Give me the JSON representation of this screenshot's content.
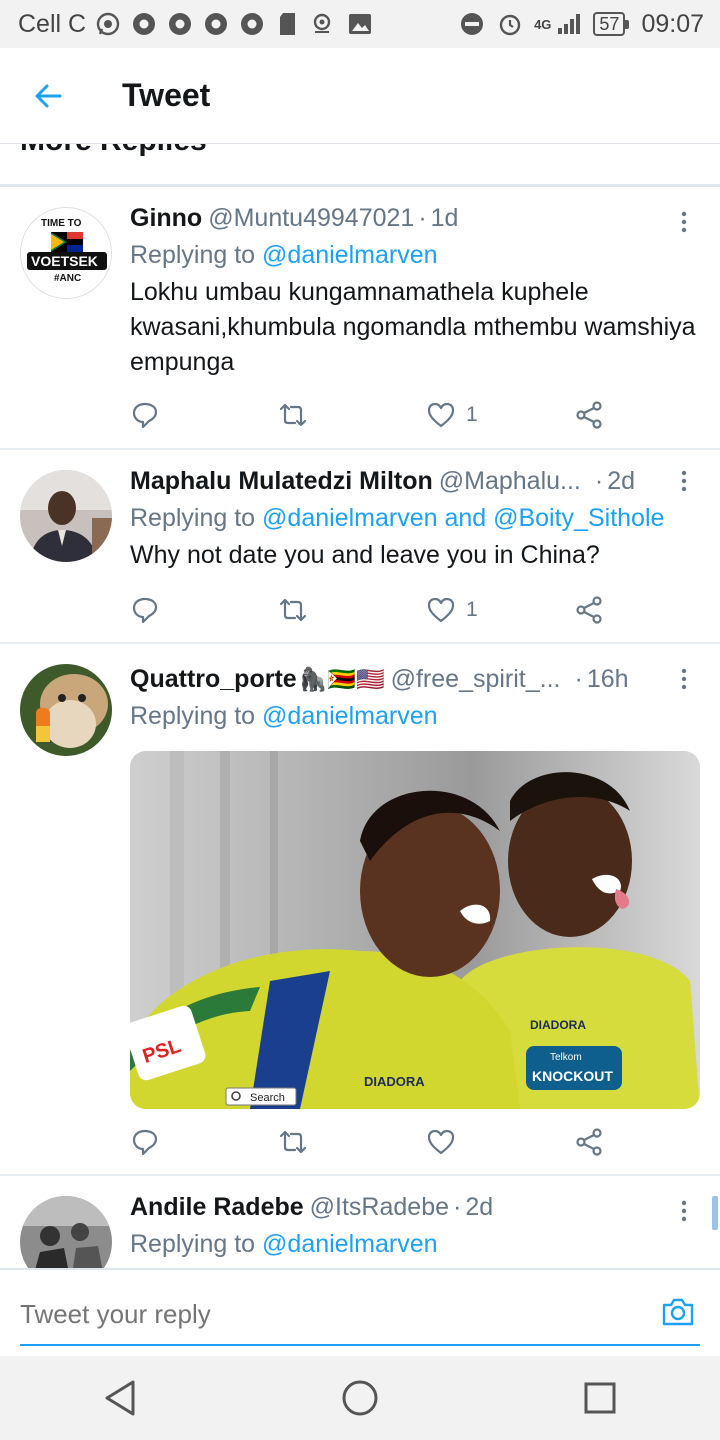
{
  "status_bar": {
    "carrier": "Cell C",
    "network": "4G",
    "battery": "57",
    "time": "09:07"
  },
  "header": {
    "title": "Tweet",
    "back_icon": "arrow-left-icon"
  },
  "section": {
    "heading": "More Replies"
  },
  "tweets": [
    {
      "name": "Ginno",
      "handle": "@Muntu49947021",
      "time": "1d",
      "replying_prefix": "Replying to",
      "mentions": "@danielmarven",
      "text": "Lokhu umbau kungamnamathela kuphele kwasani,khumbula ngomandla mthembu wamshiya empunga",
      "likes": "1",
      "avatar_caption": {
        "line1": "TIME TO",
        "line2": "VOETSEK",
        "line3": "#ANC"
      }
    },
    {
      "name": "Maphalu Mulatedzi Milton",
      "handle": "@Maphalu...",
      "time": "2d",
      "replying_prefix": "Replying to",
      "mentions": "@danielmarven and @Boity_Sithole",
      "text": "Why not date you and leave you in China?",
      "likes": "1"
    },
    {
      "name": "Quattro_porte",
      "name_emojis": "🦍🇿🇼🇺🇸",
      "handle": "@free_spirit_...",
      "time": "16h",
      "replying_prefix": "Replying to",
      "mentions": "@danielmarven",
      "likes": "",
      "media": {
        "jersey_text": "DIADORA",
        "sponsor_text": "KNOCKOUT",
        "sponsor_brand": "Telkom",
        "league_logo": "PSL",
        "search_badge": "Search"
      }
    },
    {
      "name": "Andile Radebe",
      "handle": "@ItsRadebe",
      "time": "2d",
      "replying_prefix": "Replying to",
      "mentions": "@danielmarven"
    }
  ],
  "composer": {
    "placeholder": "Tweet your reply",
    "camera_icon": "camera-icon"
  },
  "colors": {
    "accent": "#1da1f2",
    "muted": "#657786",
    "text": "#14171a"
  }
}
